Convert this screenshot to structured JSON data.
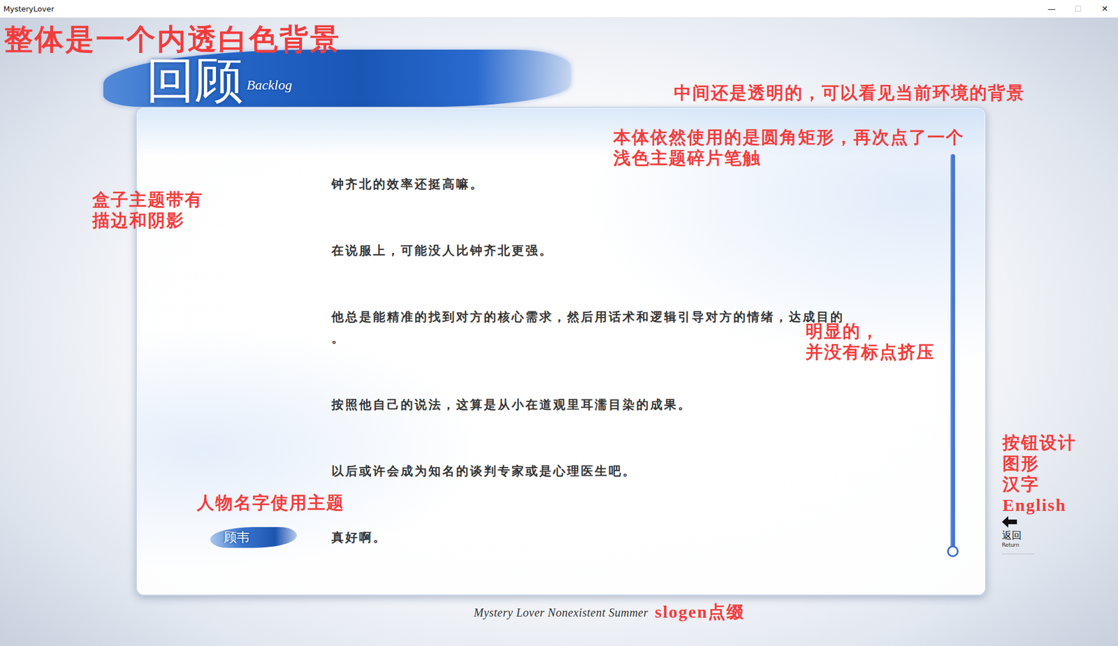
{
  "window": {
    "title": "MysteryLover",
    "controls": [
      {
        "label": "—",
        "disabled": false
      },
      {
        "label": "☐",
        "disabled": true
      },
      {
        "label": "✕",
        "disabled": false
      }
    ]
  },
  "header": {
    "title": "回顾",
    "subtitle": "Backlog"
  },
  "entries": [
    {
      "speaker": null,
      "lines": [
        "钟齐北的效率还挺高嘛。"
      ]
    },
    {
      "speaker": null,
      "lines": [
        "在说服上，可能没人比钟齐北更强。"
      ]
    },
    {
      "speaker": null,
      "lines": [
        "他总是能精准的找到对方的核心需求，然后用话术和逻辑引导对方的情绪，达成目的",
        "。"
      ]
    },
    {
      "speaker": null,
      "lines": [
        "按照他自己的说法，这算是从小在道观里耳濡目染的成果。"
      ]
    },
    {
      "speaker": null,
      "lines": [
        "以后或许会成为知名的谈判专家或是心理医生吧。"
      ]
    },
    {
      "speaker": "顾韦",
      "lines": [
        "真好啊。"
      ]
    }
  ],
  "scrollbar": {
    "level": 1
  },
  "back_button": {
    "label": "返回",
    "sublabel": "Return"
  },
  "slogan": "Mystery Lover Nonexistent Summer",
  "annotations": [
    {
      "kind": "title",
      "lines": [
        "整体是一个内透白色背景"
      ]
    },
    {
      "kind": "note",
      "lines": [
        "中间还是透明的，可以看见当前环境的背景"
      ]
    },
    {
      "kind": "note",
      "lines": [
        "本体依然使用的是圆角矩形，再次点了一个",
        "浅色主题碎片笔触"
      ]
    },
    {
      "kind": "note",
      "lines": [
        "盒子主题带有",
        "描边和阴影"
      ]
    },
    {
      "kind": "note",
      "lines": [
        "明显的，",
        "并没有标点挤压"
      ]
    },
    {
      "kind": "note",
      "lines": [
        "人物名字使用主题"
      ]
    },
    {
      "kind": "note",
      "lines": [
        "按钮设计",
        "图形",
        "汉字",
        "English"
      ]
    },
    {
      "kind": "note",
      "lines": [
        "slogen点缀"
      ]
    }
  ]
}
